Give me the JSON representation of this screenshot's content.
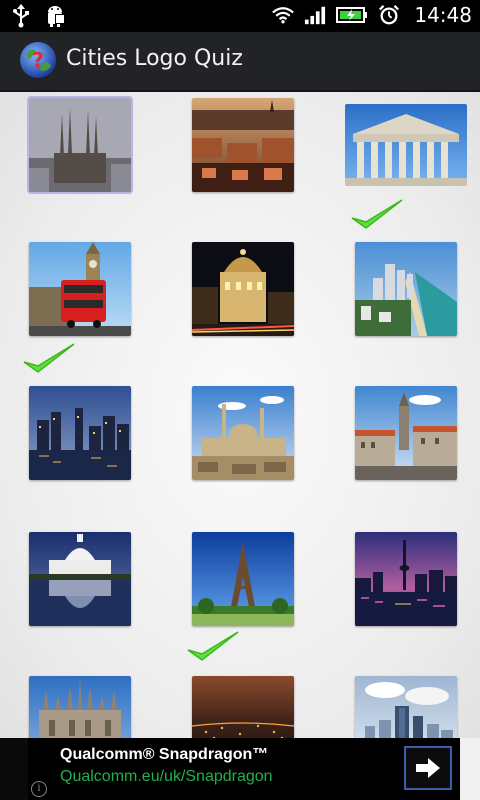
{
  "status_bar": {
    "time": "14:48",
    "icons": [
      "usb-icon",
      "android-debug-icon",
      "wifi-icon",
      "signal-icon",
      "battery-icon",
      "alarm-icon"
    ]
  },
  "app_bar": {
    "icon": "globe-question-icon",
    "title": "Cities Logo Quiz"
  },
  "grid": {
    "tiles": [
      {
        "name": "tile-barcelona",
        "scene": "sagrada-familia",
        "solved": false
      },
      {
        "name": "tile-edinburgh",
        "scene": "old-town-rooftops",
        "solved": false
      },
      {
        "name": "tile-athens",
        "scene": "parthenon",
        "solved": true
      },
      {
        "name": "tile-london",
        "scene": "big-ben-red-bus",
        "solved": true
      },
      {
        "name": "tile-madrid",
        "scene": "metropolis-building-night",
        "solved": false
      },
      {
        "name": "tile-miami",
        "scene": "beach-skyline",
        "solved": false
      },
      {
        "name": "tile-chicago",
        "scene": "skyline-dusk-water",
        "solved": false
      },
      {
        "name": "tile-cairo",
        "scene": "mosque-minarets",
        "solved": false
      },
      {
        "name": "tile-munich",
        "scene": "town-hall-tower",
        "solved": false
      },
      {
        "name": "tile-washington",
        "scene": "capitol-reflection",
        "solved": false
      },
      {
        "name": "tile-paris",
        "scene": "eiffel-tower",
        "solved": true
      },
      {
        "name": "tile-toronto",
        "scene": "cn-tower-night",
        "solved": false
      },
      {
        "name": "tile-milan",
        "scene": "cathedral-spires",
        "solved": false
      },
      {
        "name": "tile-city-night",
        "scene": "city-lights-orange-sky",
        "solved": false
      },
      {
        "name": "tile-skyscrapers",
        "scene": "modern-towers-clouds",
        "solved": false
      }
    ]
  },
  "ad": {
    "title": "Qualcomm® Snapdragon™",
    "link": "Qualcomm.eu/uk/Snapdragon",
    "info_icon": "info-icon",
    "arrow_icon": "arrow-right-icon",
    "accent": "#1fb14a"
  }
}
